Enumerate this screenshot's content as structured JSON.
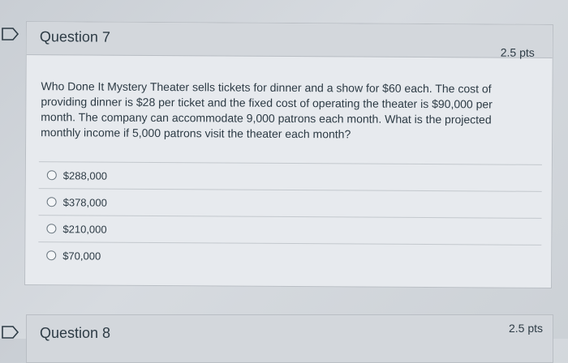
{
  "question7": {
    "title": "Question 7",
    "points": "2.5 pts",
    "text": "Who Done It Mystery Theater sells tickets for dinner and a show for $60 each. The cost of providing dinner is $28 per ticket and the fixed cost of operating the theater is $90,000 per month. The company can accommodate 9,000 patrons each month. What is the projected monthly income if 5,000 patrons visit the theater each month?",
    "answers": [
      {
        "label": "$288,000"
      },
      {
        "label": "$378,000"
      },
      {
        "label": "$210,000"
      },
      {
        "label": "$70,000"
      }
    ]
  },
  "question8": {
    "title": "Question 8",
    "points": "2.5 pts"
  },
  "colors": {
    "text": "#2d3b45",
    "header_bg": "#d3d7dc",
    "card_bg": "#e7eaee"
  }
}
